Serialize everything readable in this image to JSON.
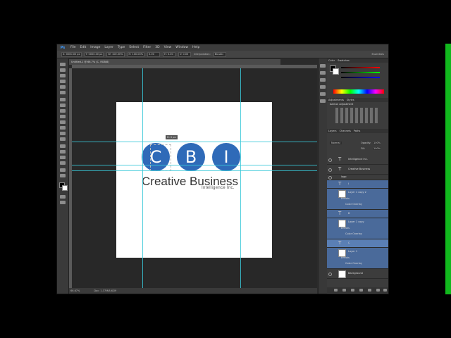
{
  "app": {
    "logo": "Ps",
    "menu": [
      "File",
      "Edit",
      "Image",
      "Layer",
      "Type",
      "Select",
      "Filter",
      "3D",
      "View",
      "Window",
      "Help"
    ]
  },
  "options_bar": {
    "fields": [
      "X: 0000.00 px",
      "Y: 0000.00 px",
      "W: 100.00%",
      "H: 100.00%",
      "0.00",
      "H: 0.00",
      "V: 0.00"
    ],
    "interpolation": "Interpolation:",
    "interpolation_value": "Bicubic",
    "workspace": "Essentials"
  },
  "document": {
    "tab_label": "Untitled-1 @ 66.7% (C, RGB/8)",
    "tooltip": "H: 0 px"
  },
  "logo_design": {
    "letters": [
      "C",
      "B",
      "I"
    ],
    "company_name": "Creative Business",
    "tagline": "Intelligence Inc.",
    "circle_color": "#2f6ab8"
  },
  "status_bar": {
    "zoom": "66.67%",
    "doc_size": "Doc: 1.37M/8.62M"
  },
  "panels": {
    "color_tabs": [
      "Color",
      "Swatches"
    ],
    "adjust_tabs": [
      "Adjustments",
      "Styles"
    ],
    "adjust_label": "Add an adjustment",
    "layers_tabs": [
      "Layers",
      "Channels",
      "Paths"
    ],
    "blend_mode": "Normal",
    "opacity_label": "Opacity:",
    "opacity_value": "100%",
    "fill_label": "Fill:",
    "fill_value": "100%",
    "layers": [
      {
        "name": "Intelligence Inc.",
        "kind": "text"
      },
      {
        "name": "Creative Business",
        "kind": "text"
      },
      {
        "name": "logo",
        "kind": "group"
      },
      {
        "name": "I",
        "kind": "text"
      },
      {
        "name": "Layer 1 copy 2",
        "kind": "shape",
        "effects": "Effects",
        "overlay": "Color Overlay"
      },
      {
        "name": "B",
        "kind": "text"
      },
      {
        "name": "Layer 1 copy",
        "kind": "shape",
        "effects": "Effects",
        "overlay": "Color Overlay"
      },
      {
        "name": "C",
        "kind": "text",
        "selected": true
      },
      {
        "name": "Layer 1",
        "kind": "shape",
        "effects": "Effects",
        "overlay": "Color Overlay"
      },
      {
        "name": "Background",
        "kind": "bg"
      }
    ]
  }
}
